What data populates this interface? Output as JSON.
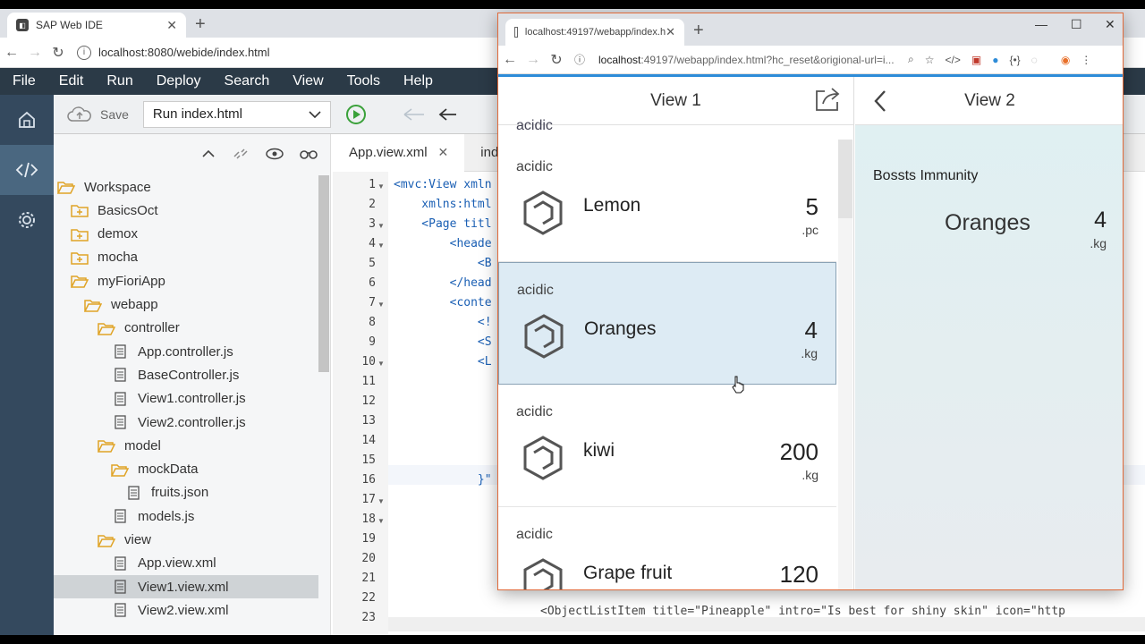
{
  "ide": {
    "tab_title": "SAP Web IDE",
    "url": "localhost:8080/webide/index.html",
    "menu": [
      "File",
      "Edit",
      "Run",
      "Deploy",
      "Search",
      "View",
      "Tools",
      "Help"
    ],
    "toolbar": {
      "save_label": "Save",
      "run_config": "Run index.html"
    },
    "tree": [
      {
        "label": "Workspace",
        "type": "folder-open",
        "depth": 0
      },
      {
        "label": "BasicsOct",
        "type": "folder-plus",
        "depth": 1
      },
      {
        "label": "demox",
        "type": "folder-plus",
        "depth": 1
      },
      {
        "label": "mocha",
        "type": "folder-plus",
        "depth": 1
      },
      {
        "label": "myFioriApp",
        "type": "folder-open",
        "depth": 1
      },
      {
        "label": "webapp",
        "type": "folder-open",
        "depth": 2
      },
      {
        "label": "controller",
        "type": "folder-open",
        "depth": 3
      },
      {
        "label": "App.controller.js",
        "type": "file",
        "depth": 4
      },
      {
        "label": "BaseController.js",
        "type": "file",
        "depth": 4
      },
      {
        "label": "View1.controller.js",
        "type": "file",
        "depth": 4
      },
      {
        "label": "View2.controller.js",
        "type": "file",
        "depth": 4
      },
      {
        "label": "model",
        "type": "folder-open",
        "depth": 3
      },
      {
        "label": "mockData",
        "type": "folder-open",
        "depth": 4
      },
      {
        "label": "fruits.json",
        "type": "file",
        "depth": 5
      },
      {
        "label": "models.js",
        "type": "file",
        "depth": 4
      },
      {
        "label": "view",
        "type": "folder-open",
        "depth": 3
      },
      {
        "label": "App.view.xml",
        "type": "file",
        "depth": 4
      },
      {
        "label": "View1.view.xml",
        "type": "file",
        "depth": 4,
        "selected": true
      },
      {
        "label": "View2.view.xml",
        "type": "file",
        "depth": 4
      }
    ],
    "editor_tabs": [
      {
        "label": "App.view.xml",
        "active": true
      },
      {
        "label": "ind",
        "active": false
      }
    ],
    "line_numbers": [
      "1",
      "2",
      "3",
      "4",
      "5",
      "6",
      "7",
      "8",
      "9",
      "10",
      "11",
      "12",
      "13",
      "14",
      "15",
      "16",
      "17",
      "18",
      "19",
      "20",
      "21",
      "22",
      "23"
    ],
    "code_lines": [
      {
        "ln": 1,
        "text": "<mvc:View xmln"
      },
      {
        "ln": 2,
        "text": "    xmlns:html"
      },
      {
        "ln": 3,
        "text": "    <Page titl"
      },
      {
        "ln": 4,
        "text": "        <heade"
      },
      {
        "ln": 5,
        "text": "            <B"
      },
      {
        "ln": 6,
        "text": "        </head"
      },
      {
        "ln": 7,
        "text": "        <conte"
      },
      {
        "ln": 8,
        "text": "            <!"
      },
      {
        "ln": 9,
        "text": "            <S"
      },
      {
        "ln": 10,
        "text": "            <L"
      },
      {
        "ln": 16,
        "text": "            }\""
      }
    ],
    "bottom_code": "<ObjectListItem title=\"Pineapple\" intro=\"Is best for shiny skin\" icon=\"http"
  },
  "preview": {
    "tab_title": "localhost:49197/webapp/index.h",
    "url_host": "localhost",
    "url_path": ":49197/webapp/index.html?hc_reset&origional-url=i...",
    "master_title": "View 1",
    "group_peek": "acidic",
    "items": [
      {
        "intro": "acidic",
        "title": "Lemon",
        "number": "5",
        "unit": ".pc",
        "selected": false
      },
      {
        "intro": "acidic",
        "title": "Oranges",
        "number": "4",
        "unit": ".kg",
        "selected": true
      },
      {
        "intro": "acidic",
        "title": "kiwi",
        "number": "200",
        "unit": ".kg",
        "selected": false
      },
      {
        "intro": "acidic",
        "title": "Grape fruit",
        "number": "120",
        "unit": "",
        "selected": false
      }
    ],
    "detail_title": "View 2",
    "detail": {
      "intro": "Bossts Immunity",
      "title": "Oranges",
      "number": "4",
      "unit": ".kg"
    }
  },
  "colors": {
    "menubar": "#2b3a47",
    "rail": "#34495e",
    "accent": "#2e8cd8",
    "selected_item": "#ddebf4"
  }
}
